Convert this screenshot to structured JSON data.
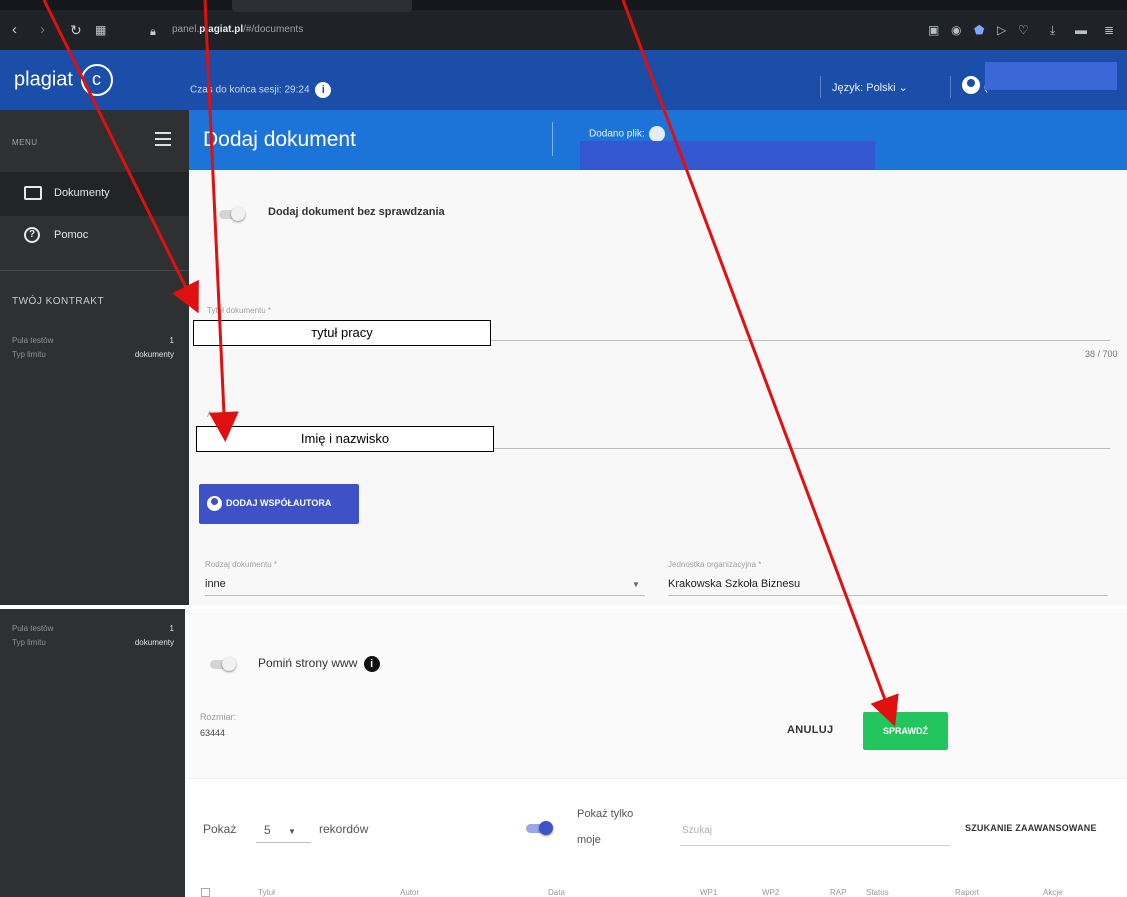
{
  "browser": {
    "url_prefix": "panel.",
    "url_domain": "plagiat.pl",
    "url_path": "/#/documents"
  },
  "header": {
    "logo_text": "plagiat",
    "logo_mark": "c",
    "session_label": "Czas do końca sesji: 29:24",
    "info_mark": "i",
    "language_label": "Język: Polski",
    "user_initial": "("
  },
  "sidebar": {
    "menu_label": "MENU",
    "items": [
      {
        "label": "Dokumenty",
        "icon": "folder-icon",
        "active": true
      },
      {
        "label": "Pomoc",
        "icon": "help-icon",
        "active": false
      }
    ],
    "help_glyph": "?",
    "contract_title": "TWÓJ KONTRAKT",
    "tests_pool_label": "Pula testów",
    "tests_pool_value": "1",
    "limit_type_label": "Typ limitu",
    "limit_type_value": "dokumenty"
  },
  "page": {
    "title": "Dodaj dokument",
    "added_file_label": "Dodano plik:"
  },
  "form": {
    "toggle_no_check_label": "Dodaj dokument bez sprawdzania",
    "toggle_no_check_on": false,
    "title_label": "Tytuł dokumentu *",
    "title_value": "тytuł pracy",
    "title_counter": "38 / 700",
    "author_label": "Autor",
    "author_value": "Imię i nazwisko",
    "add_coauthor_button": "DODAJ WSPÓŁAUTORA",
    "doc_type_label": "Rodzaj dokumentu *",
    "doc_type_value": "inne",
    "org_unit_label": "Jednostka organizacyjna *",
    "org_unit_value": "Krakowska Szkoła Biznesu",
    "skip_www_label": "Pomiń strony www",
    "skip_www_on": false,
    "size_label": "Rozmiar:",
    "size_value": "63444",
    "cancel_button": "ANULUJ",
    "check_button": "SPRAWDŹ"
  },
  "records": {
    "show_label": "Pokaż",
    "page_size": "5",
    "records_label": "rekordów",
    "only_mine_line1": "Pokaż tylko",
    "only_mine_line2": "moje",
    "only_mine_on": true,
    "search_placeholder": "Szukaj",
    "advanced_search": "SZUKANIE ZAAWANSOWANE",
    "columns": [
      "Tytuł",
      "Autor",
      "Data",
      "WP1",
      "WP2",
      "RAP",
      "Status",
      "Raport",
      "Akcje"
    ]
  },
  "colors": {
    "header_blue": "#1a4ea8",
    "page_header_blue": "#1c74d8",
    "sidebar_dark": "#2e3032",
    "check_green": "#22c55e",
    "coauthor_indigo": "#3f51c7",
    "arrow_red": "#e01010"
  }
}
